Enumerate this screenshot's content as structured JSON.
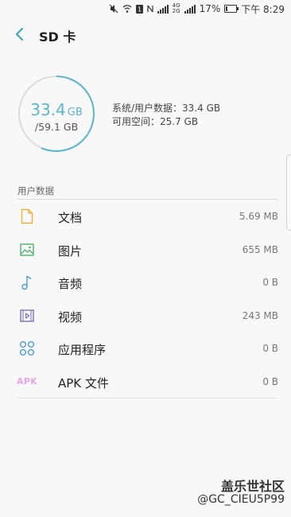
{
  "status_bar": {
    "battery": "17%",
    "time": "下午 8:29",
    "net_top": "4G",
    "net_bottom": "2G",
    "battery_level": 0.17
  },
  "app_bar": {
    "title": "SD 卡"
  },
  "storage": {
    "used_value": "33.4",
    "used_unit": "GB",
    "total": "/59.1 GB",
    "used_fraction": 0.565,
    "system_user_data": "系统/用户数据：33.4 GB",
    "available_space": "可用空间：25.7 GB",
    "accent_color": "#5ab5cf"
  },
  "user_data": {
    "header": "用户数据",
    "items": [
      {
        "label": "文档",
        "size": "5.69 MB",
        "icon": "document-icon",
        "color": "#f0b040"
      },
      {
        "label": "图片",
        "size": "655 MB",
        "icon": "image-icon",
        "color": "#4caf6a"
      },
      {
        "label": "音频",
        "size": "0 B",
        "icon": "music-note-icon",
        "color": "#4a9fd8"
      },
      {
        "label": "视频",
        "size": "243 MB",
        "icon": "video-icon",
        "color": "#7a6fc2"
      },
      {
        "label": "应用程序",
        "size": "0 B",
        "icon": "apps-icon",
        "color": "#4a9fd8"
      },
      {
        "label": "APK 文件",
        "size": "0 B",
        "icon": "apk-icon",
        "icon_text": "APK",
        "color": "#e6a6e6"
      }
    ]
  },
  "watermark": {
    "brand": "盖乐世社区",
    "user": "@GC_CIEU5P99"
  }
}
